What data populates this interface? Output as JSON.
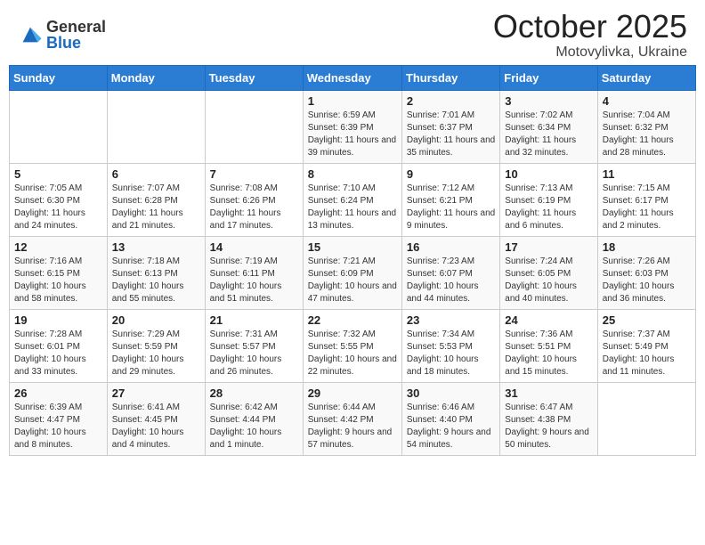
{
  "logo": {
    "general": "General",
    "blue": "Blue"
  },
  "header": {
    "month": "October 2025",
    "location": "Motovylivka, Ukraine"
  },
  "days_of_week": [
    "Sunday",
    "Monday",
    "Tuesday",
    "Wednesday",
    "Thursday",
    "Friday",
    "Saturday"
  ],
  "weeks": [
    [
      {
        "day": "",
        "info": ""
      },
      {
        "day": "",
        "info": ""
      },
      {
        "day": "",
        "info": ""
      },
      {
        "day": "1",
        "info": "Sunrise: 6:59 AM\nSunset: 6:39 PM\nDaylight: 11 hours and 39 minutes."
      },
      {
        "day": "2",
        "info": "Sunrise: 7:01 AM\nSunset: 6:37 PM\nDaylight: 11 hours and 35 minutes."
      },
      {
        "day": "3",
        "info": "Sunrise: 7:02 AM\nSunset: 6:34 PM\nDaylight: 11 hours and 32 minutes."
      },
      {
        "day": "4",
        "info": "Sunrise: 7:04 AM\nSunset: 6:32 PM\nDaylight: 11 hours and 28 minutes."
      }
    ],
    [
      {
        "day": "5",
        "info": "Sunrise: 7:05 AM\nSunset: 6:30 PM\nDaylight: 11 hours and 24 minutes."
      },
      {
        "day": "6",
        "info": "Sunrise: 7:07 AM\nSunset: 6:28 PM\nDaylight: 11 hours and 21 minutes."
      },
      {
        "day": "7",
        "info": "Sunrise: 7:08 AM\nSunset: 6:26 PM\nDaylight: 11 hours and 17 minutes."
      },
      {
        "day": "8",
        "info": "Sunrise: 7:10 AM\nSunset: 6:24 PM\nDaylight: 11 hours and 13 minutes."
      },
      {
        "day": "9",
        "info": "Sunrise: 7:12 AM\nSunset: 6:21 PM\nDaylight: 11 hours and 9 minutes."
      },
      {
        "day": "10",
        "info": "Sunrise: 7:13 AM\nSunset: 6:19 PM\nDaylight: 11 hours and 6 minutes."
      },
      {
        "day": "11",
        "info": "Sunrise: 7:15 AM\nSunset: 6:17 PM\nDaylight: 11 hours and 2 minutes."
      }
    ],
    [
      {
        "day": "12",
        "info": "Sunrise: 7:16 AM\nSunset: 6:15 PM\nDaylight: 10 hours and 58 minutes."
      },
      {
        "day": "13",
        "info": "Sunrise: 7:18 AM\nSunset: 6:13 PM\nDaylight: 10 hours and 55 minutes."
      },
      {
        "day": "14",
        "info": "Sunrise: 7:19 AM\nSunset: 6:11 PM\nDaylight: 10 hours and 51 minutes."
      },
      {
        "day": "15",
        "info": "Sunrise: 7:21 AM\nSunset: 6:09 PM\nDaylight: 10 hours and 47 minutes."
      },
      {
        "day": "16",
        "info": "Sunrise: 7:23 AM\nSunset: 6:07 PM\nDaylight: 10 hours and 44 minutes."
      },
      {
        "day": "17",
        "info": "Sunrise: 7:24 AM\nSunset: 6:05 PM\nDaylight: 10 hours and 40 minutes."
      },
      {
        "day": "18",
        "info": "Sunrise: 7:26 AM\nSunset: 6:03 PM\nDaylight: 10 hours and 36 minutes."
      }
    ],
    [
      {
        "day": "19",
        "info": "Sunrise: 7:28 AM\nSunset: 6:01 PM\nDaylight: 10 hours and 33 minutes."
      },
      {
        "day": "20",
        "info": "Sunrise: 7:29 AM\nSunset: 5:59 PM\nDaylight: 10 hours and 29 minutes."
      },
      {
        "day": "21",
        "info": "Sunrise: 7:31 AM\nSunset: 5:57 PM\nDaylight: 10 hours and 26 minutes."
      },
      {
        "day": "22",
        "info": "Sunrise: 7:32 AM\nSunset: 5:55 PM\nDaylight: 10 hours and 22 minutes."
      },
      {
        "day": "23",
        "info": "Sunrise: 7:34 AM\nSunset: 5:53 PM\nDaylight: 10 hours and 18 minutes."
      },
      {
        "day": "24",
        "info": "Sunrise: 7:36 AM\nSunset: 5:51 PM\nDaylight: 10 hours and 15 minutes."
      },
      {
        "day": "25",
        "info": "Sunrise: 7:37 AM\nSunset: 5:49 PM\nDaylight: 10 hours and 11 minutes."
      }
    ],
    [
      {
        "day": "26",
        "info": "Sunrise: 6:39 AM\nSunset: 4:47 PM\nDaylight: 10 hours and 8 minutes."
      },
      {
        "day": "27",
        "info": "Sunrise: 6:41 AM\nSunset: 4:45 PM\nDaylight: 10 hours and 4 minutes."
      },
      {
        "day": "28",
        "info": "Sunrise: 6:42 AM\nSunset: 4:44 PM\nDaylight: 10 hours and 1 minute."
      },
      {
        "day": "29",
        "info": "Sunrise: 6:44 AM\nSunset: 4:42 PM\nDaylight: 9 hours and 57 minutes."
      },
      {
        "day": "30",
        "info": "Sunrise: 6:46 AM\nSunset: 4:40 PM\nDaylight: 9 hours and 54 minutes."
      },
      {
        "day": "31",
        "info": "Sunrise: 6:47 AM\nSunset: 4:38 PM\nDaylight: 9 hours and 50 minutes."
      },
      {
        "day": "",
        "info": ""
      }
    ]
  ]
}
